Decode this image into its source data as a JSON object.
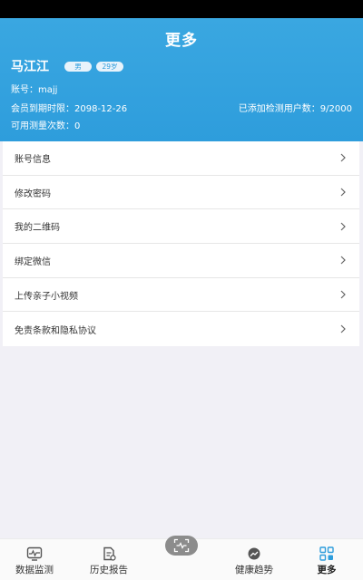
{
  "header": {
    "title": "更多",
    "user_name": "马江江",
    "gender": "男",
    "age": "29岁",
    "account": "账号：majj",
    "expiry": "会员到期时限：2098-12-26",
    "added_users": "已添加检测用户数：9/2000",
    "remaining_tests": "可用测量次数：0"
  },
  "menu": {
    "items": [
      {
        "label": "账号信息"
      },
      {
        "label": "修改密码"
      },
      {
        "label": "我的二维码"
      },
      {
        "label": "绑定微信"
      },
      {
        "label": "上传亲子小视频"
      },
      {
        "label": "免责条款和隐私协议"
      }
    ]
  },
  "tabbar": {
    "tabs": [
      {
        "label": "数据监测",
        "icon": "heartbeat-monitor-icon"
      },
      {
        "label": "历史报告",
        "icon": "report-icon"
      },
      {
        "label": "健康趋势",
        "icon": "trend-icon"
      },
      {
        "label": "更多",
        "icon": "grid-more-icon"
      }
    ],
    "center_icon": "scan-icon"
  },
  "colors": {
    "header_blue": "#2e9ddc",
    "active_tab": "#2e9ddc",
    "background": "#f1f0f6"
  }
}
